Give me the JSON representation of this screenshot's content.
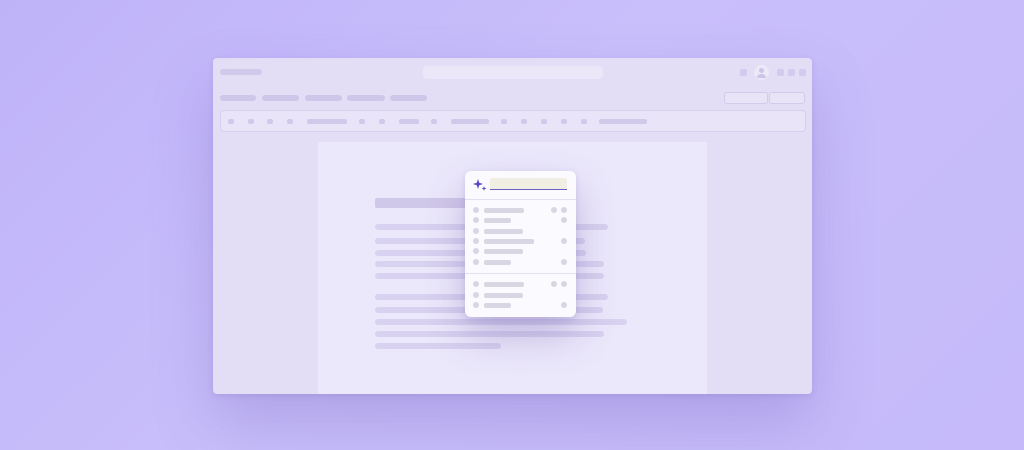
{
  "colors": {
    "background": "#c6bafa",
    "window": "#e3ddf5",
    "document": "#ece8fb",
    "popup": "#fbfaff",
    "accent": "#5646c8"
  },
  "popup": {
    "icon": "sparkle-icon",
    "input_value": "",
    "groups": [
      {
        "items": [
          {
            "icon": "dot-icon",
            "shortcut_keys": 2
          },
          {
            "icon": "dot-icon",
            "shortcut_keys": 1
          },
          {
            "icon": "dot-icon",
            "shortcut_keys": 0
          },
          {
            "icon": "dot-icon",
            "shortcut_keys": 1
          },
          {
            "icon": "dot-icon",
            "shortcut_keys": 0
          },
          {
            "icon": "dot-icon",
            "shortcut_keys": 1
          }
        ]
      },
      {
        "items": [
          {
            "icon": "dot-icon",
            "shortcut_keys": 2
          },
          {
            "icon": "dot-icon",
            "shortcut_keys": 0
          },
          {
            "icon": "dot-icon",
            "shortcut_keys": 1
          }
        ]
      }
    ]
  },
  "header": {
    "search_placeholder": "",
    "user_icon": "user-icon"
  }
}
